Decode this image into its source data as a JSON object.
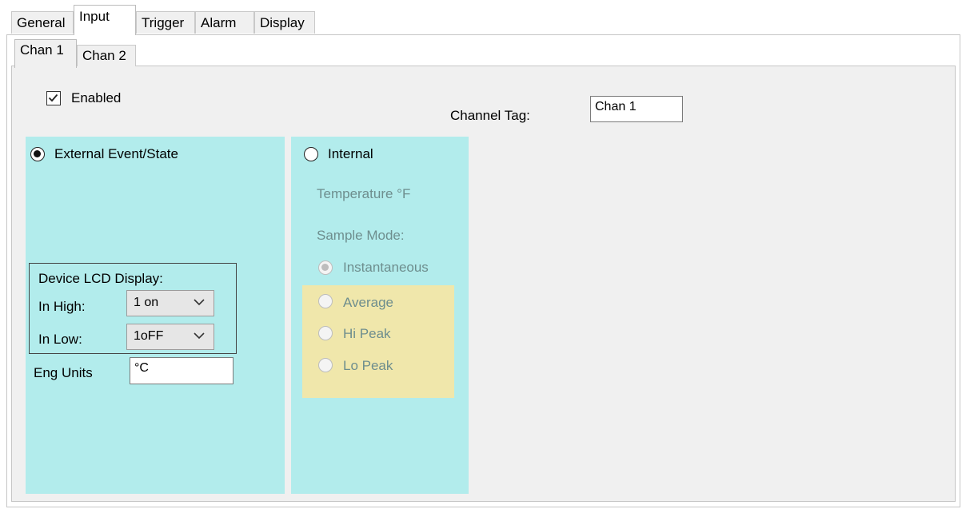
{
  "tabs": [
    {
      "label": "General"
    },
    {
      "label": "Input"
    },
    {
      "label": "Trigger"
    },
    {
      "label": "Alarm"
    },
    {
      "label": "Display"
    }
  ],
  "active_tab": "Input",
  "channel_tabs": [
    {
      "label": "Chan 1"
    },
    {
      "label": "Chan 2"
    }
  ],
  "active_channel": "Chan 1",
  "enabled": {
    "label": "Enabled",
    "checked": true
  },
  "channel_tag": {
    "label": "Channel Tag:",
    "value": "Chan 1"
  },
  "external": {
    "label": "External Event/State",
    "selected": true,
    "lcd": {
      "title": "Device LCD Display:",
      "in_high_label": "In High:",
      "in_high_value": "1 on",
      "in_low_label": "In Low:",
      "in_low_value": "1oFF"
    },
    "eng_units_label": "Eng Units",
    "eng_units_value": "°C"
  },
  "internal": {
    "label": "Internal",
    "selected": false,
    "temperature": "Temperature °F",
    "sample_mode_label": "Sample Mode:",
    "modes": [
      {
        "label": "Instantaneous",
        "selected": true
      },
      {
        "label": "Average",
        "selected": false
      },
      {
        "label": "Hi Peak",
        "selected": false
      },
      {
        "label": "Lo Peak",
        "selected": false
      }
    ]
  },
  "colors": {
    "panel_cyan": "#b2ecec",
    "highlight_yellow": "#f0e7ab",
    "window_bg": "#f0f0f0"
  }
}
